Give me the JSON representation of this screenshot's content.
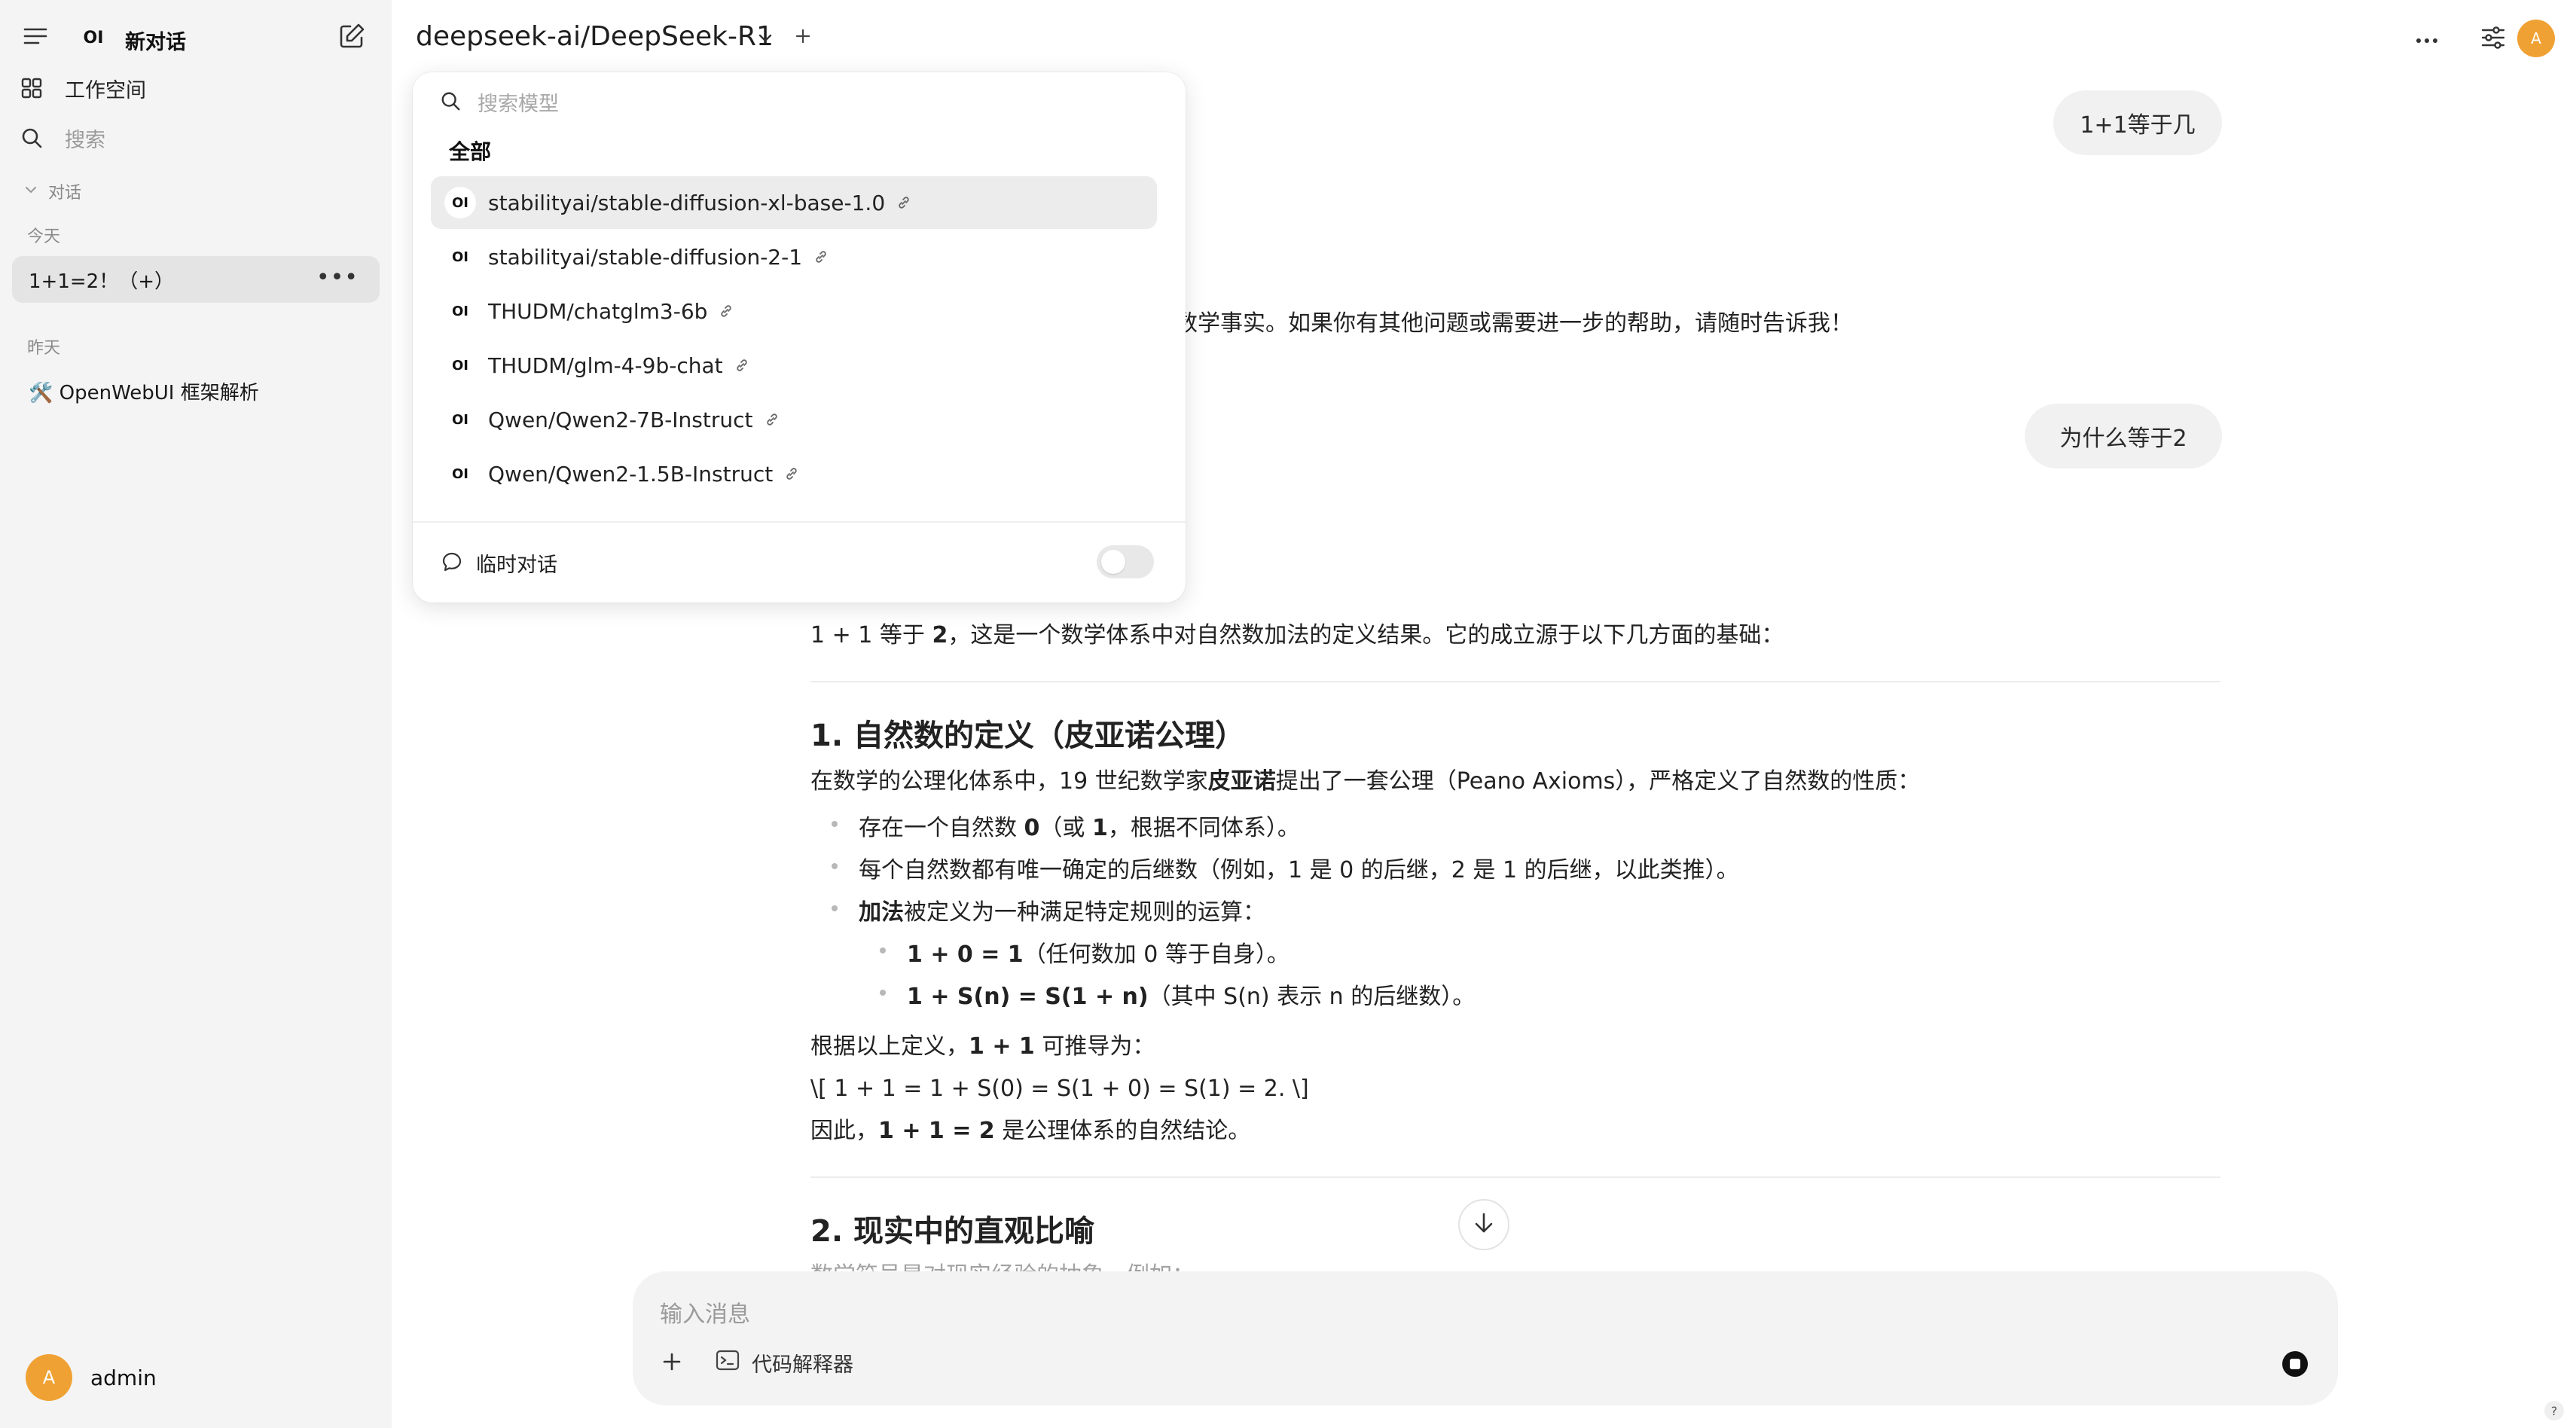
{
  "sidebar": {
    "logo": "OI",
    "title": "新对话",
    "workspace_label": "工作空间",
    "search_placeholder": "搜索",
    "section_label": "对话",
    "today_label": "今天",
    "today_items": [
      {
        "title": "1+1=2！（+）"
      }
    ],
    "yesterday_label": "昨天",
    "yesterday_items": [
      {
        "title": "🛠️ OpenWebUI 框架解析"
      }
    ],
    "user": {
      "avatar_letter": "A",
      "name": "admin"
    }
  },
  "topbar": {
    "model_name": "deepseek-ai/DeepSeek-R1",
    "avatar_letter": "A"
  },
  "dropdown": {
    "search_placeholder": "搜索模型",
    "all_label": "全部",
    "items": [
      {
        "logo": "OI",
        "name": "stabilityai/stable-diffusion-xl-base-1.0"
      },
      {
        "logo": "OI",
        "name": "stabilityai/stable-diffusion-2-1"
      },
      {
        "logo": "OI",
        "name": "THUDM/chatglm3-6b"
      },
      {
        "logo": "OI",
        "name": "THUDM/glm-4-9b-chat"
      },
      {
        "logo": "OI",
        "name": "Qwen/Qwen2-7B-Instruct"
      },
      {
        "logo": "OI",
        "name": "Qwen/Qwen2-1.5B-Instruct"
      }
    ],
    "temporary_chat_label": "临时对话",
    "temporary_chat_enabled": false
  },
  "chat": {
    "user_msg_1": "1+1等于几",
    "partial_reply": "数学事实。如果你有其他问题或需要进一步的帮助，请随时告诉我！",
    "user_msg_2": "为什么等于2",
    "intro_a": "1 + 1 等于 ",
    "intro_b": "2",
    "intro_c": "，这是一个数学体系中对自然数加法的定义结果。它的成立源于以下几方面的基础：",
    "h1": "1. 自然数的定义（皮亚诺公理）",
    "p1_a": "在数学的公理化体系中，19 世纪数学家",
    "p1_b": "皮亚诺",
    "p1_c": "提出了一套公理（Peano Axioms），严格定义了自然数的性质：",
    "b1_a": "存在一个自然数 ",
    "b1_b": "0",
    "b1_c": "（或 ",
    "b1_d": "1",
    "b1_e": "，根据不同体系）。",
    "b2": "每个自然数都有唯一确定的后继数（例如，1 是 0 的后继，2 是 1 的后继，以此类推）。",
    "b3_a": "加法",
    "b3_b": "被定义为一种满足特定规则的运算：",
    "sb1_a": "1 + 0 = 1",
    "sb1_b": "（任何数加 0 等于自身）。",
    "sb2_a": "1 + S(n) = S(1 + n)",
    "sb2_b": "（其中 S(n) 表示 n 的后继数）。",
    "p2_a": "根据以上定义，",
    "p2_b": "1 + 1",
    "p2_c": " 可推导为：",
    "p3": "\\[ 1 + 1 = 1 + S(0) = S(1 + 0) = S(1) = 2. \\]",
    "p4_a": "因此，",
    "p4_b": "1 + 1 = 2",
    "p4_c": " 是公理体系的自然结论。",
    "h2": "2. 现实中的直观比喻",
    "faded_line": "数学符号是对现实经验的抽象，例如："
  },
  "composer": {
    "placeholder": "输入消息",
    "tool_label": "代码解释器"
  },
  "help_label": "?"
}
